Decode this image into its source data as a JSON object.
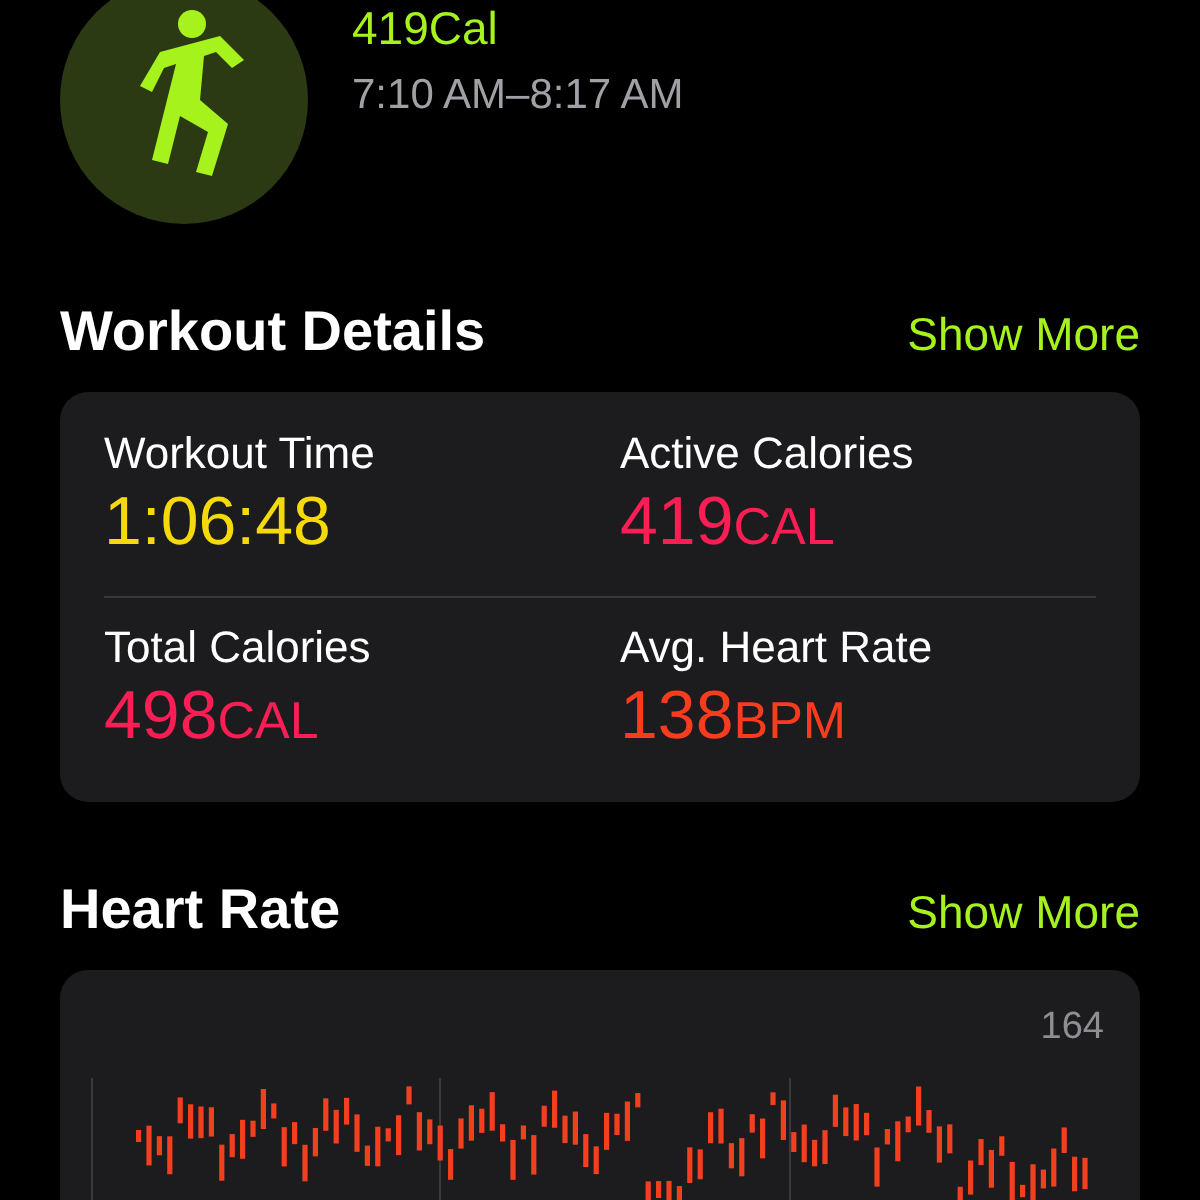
{
  "workout": {
    "calories": "419Cal",
    "time_range": "7:10 AM–8:17 AM"
  },
  "workout_details": {
    "title": "Workout Details",
    "action": "Show More",
    "metrics": [
      {
        "label": "Workout Time",
        "value": "1:06:48",
        "color": "#f5d90a"
      },
      {
        "label": "Active Calories",
        "value": "419",
        "unit": "CAL",
        "color": "#fa1e55"
      },
      {
        "label": "Total Calories",
        "value": "498",
        "unit": "CAL",
        "color": "#fa1e55"
      },
      {
        "label": "Avg. Heart Rate",
        "value": "138",
        "unit": "BPM",
        "color": "#fa3c1e"
      }
    ]
  },
  "heart_rate": {
    "title": "Heart Rate",
    "action": "Show More",
    "max_label": "164"
  }
}
